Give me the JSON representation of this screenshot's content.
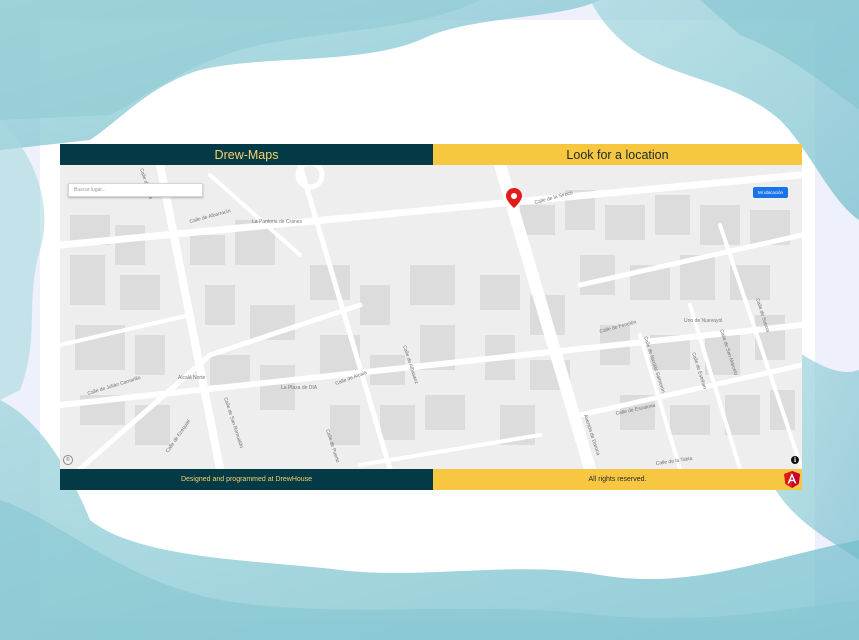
{
  "header": {
    "brand": "Drew-Maps",
    "section_title": "Look for a location"
  },
  "map": {
    "search": {
      "placeholder": "Buscar lugar..."
    },
    "my_location_label": "Mi ubicación",
    "info_icon": "info-icon",
    "marker_color": "#e21b1b",
    "streets": [
      "Calle de Albarracín",
      "Calle de la Siroco",
      "Calle de Julián Camarillo",
      "Calle de San Romualdo",
      "Calle de Alcalá",
      "Calle de Albasanz",
      "Calle de Ezequiel",
      "Calle de Puerto",
      "Calle de Fenelón",
      "Calle de Escalona",
      "Calle de Nicolás Salmerón",
      "Avenida de Daroca",
      "Calle de Esteban",
      "Calle de la Tabla",
      "Calle de San Marcelo",
      "Calle de Suecia",
      "Calle de Goya"
    ],
    "places": [
      "La Pantoria de Cranes",
      "Alcalá Norte",
      "La Plaza de DIA",
      "Uno de Nuevayol"
    ]
  },
  "footer": {
    "credit": "Designed and programmed at DrewHouse",
    "rights": "All rights reserved.",
    "framework_icon": "angular-icon"
  },
  "colors": {
    "header_dark": "#043a46",
    "header_yellow": "#f7c742",
    "brand_text": "#f5d26a",
    "button_blue": "#1a73e8"
  }
}
